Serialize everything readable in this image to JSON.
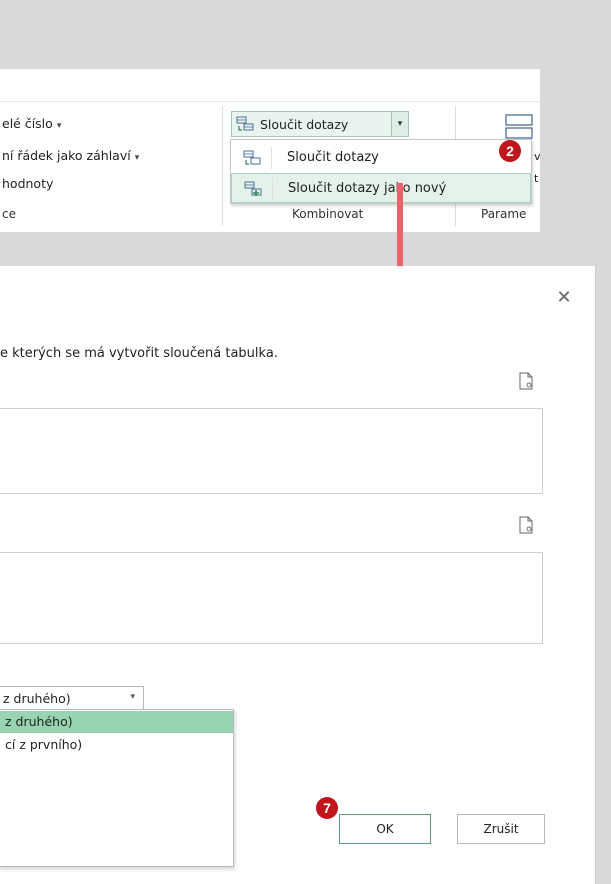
{
  "ribbon": {
    "items": [
      {
        "label": "elé číslo",
        "caret": "▾"
      },
      {
        "label": "ní řádek jako záhlaví",
        "caret": "▾"
      },
      {
        "label": "hodnoty",
        "caret": ""
      },
      {
        "label": "ce",
        "caret": ""
      }
    ],
    "merge_button": {
      "label": "Sloučit dotazy",
      "caret": "▾"
    },
    "menu": [
      {
        "label": "Sloučit dotazy",
        "icon": "merge-queries-icon",
        "highlighted": false
      },
      {
        "label": "Sloučit dotazy jako nový",
        "icon": "merge-queries-as-new-icon",
        "highlighted": true
      }
    ],
    "group_labels": {
      "combine": "Kombinovat",
      "params": "Parame"
    },
    "badge_2": "2",
    "accent": "#c0161b"
  },
  "dialog": {
    "close": "✕",
    "description": "e kterých se má vytvořit sloučená tabulka.",
    "join_kind": {
      "selected": "z druhého)",
      "caret": "▾",
      "options": [
        "z druhého)",
        "cí z prvního)"
      ]
    },
    "badge_7": "7",
    "ok_label": "OK",
    "cancel_label": "Zrušit"
  },
  "colors": {
    "highlight_green": "#e4f2ea",
    "selected_green": "#98d4b0",
    "arrow": "#e8646a",
    "badge_red": "#c0161b"
  }
}
